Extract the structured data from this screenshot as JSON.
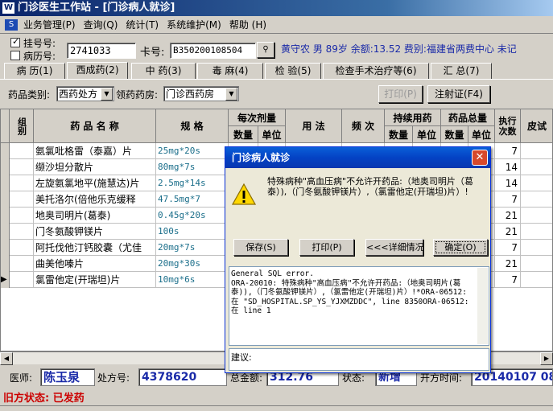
{
  "window": {
    "title": "门诊医生工作站 - [门诊病人就诊]"
  },
  "menu": [
    "业务管理(P)",
    "查询(Q)",
    "统计(T)",
    "系统维护(M)",
    "帮助 (H)"
  ],
  "patient": {
    "regno_label": "挂号号:",
    "caseno_label": "病历号:",
    "regno_value": "2741033",
    "card_label": "卡号:",
    "card_value": "B350200108504",
    "info": "黄守农 男 89岁 余额:13.52 费别:福建省两费中心 未记"
  },
  "tabs": [
    "病 历(1)",
    "西成药(2)",
    "中 药(3)",
    "毒 麻(4)",
    "检 验(5)",
    "检查手术治疗等(6)",
    "汇 总(7)"
  ],
  "toolbar": {
    "category_label": "药品类别:",
    "category_value": "西药处方",
    "pharmacy_label": "领药药房:",
    "pharmacy_value": "门诊西药房",
    "print_button": "打印(P)",
    "injection_button": "注射证(F4)"
  },
  "grid": {
    "headers": {
      "group": "组别",
      "name": "药 品 名 称",
      "spec": "规 格",
      "dose": "每次剂量",
      "dose_qty": "数量",
      "dose_unit": "单位",
      "usage": "用 法",
      "freq": "频 次",
      "duration": "持续用药",
      "dur_qty": "数量",
      "dur_unit": "单位",
      "total": "药品总量",
      "tot_qty": "数量",
      "tot_unit": "单位",
      "exec": "执行次数",
      "skin": "皮试"
    },
    "rows": [
      {
        "name": "氨氯吡格雷（泰嘉）片",
        "spec": "25mg*20s",
        "exec": "7",
        "marker": ""
      },
      {
        "name": "缬沙坦分散片",
        "spec": "80mg*7s",
        "exec": "14",
        "marker": ""
      },
      {
        "name": "左旋氨氯地平(施慧达)片",
        "spec": "2.5mg*14s",
        "exec": "14",
        "marker": ""
      },
      {
        "name": "美托洛尔(倍他乐克缓释",
        "spec": "47.5mg*7",
        "exec": "7",
        "marker": ""
      },
      {
        "name": "地奥司明片(葛泰)",
        "spec": "0.45g*20s",
        "exec": "21",
        "marker": ""
      },
      {
        "name": "门冬氨酸钾镁片",
        "spec": "100s",
        "exec": "21",
        "marker": ""
      },
      {
        "name": "阿托伐他汀钙胶囊（尤佳",
        "spec": "20mg*7s",
        "exec": "7",
        "marker": ""
      },
      {
        "name": "曲美他嗪片",
        "spec": "20mg*30s",
        "exec": "21",
        "marker": ""
      },
      {
        "name": "氯雷他定(开瑞坦)片",
        "spec": "10mg*6s",
        "exec": "7",
        "marker": "▶"
      }
    ]
  },
  "footer": {
    "doctor_label": "医师:",
    "doctor_value": "陈玉泉",
    "rx_label": "处方号:",
    "rx_value": "4378620",
    "total_label": "总金额:",
    "total_value": "312.76",
    "status_label": "状态:",
    "status_value": "新增",
    "open_time_label": "开方时间:",
    "open_time_value": "20140107 08",
    "old_status": "旧方状态: 已发药"
  },
  "dialog": {
    "title": "门诊病人就诊",
    "message": "特殊病种\"高血压病\"不允许开药品:（地奥司明片（葛泰）),（门冬氨酸钾镁片）,（氯雷他定(开瑞坦)片）!",
    "save_button": "保存(S)",
    "print_button": "打印(P)",
    "details_button": "<<<详细情况",
    "ok_button": "确定(O)",
    "log": "General SQL error.\nORA-20010: 特殊病种\"高血压病\"不允许开药品:（地奥司明片(葛泰)),（门冬氨酸钾镁片）,（氯雷他定(开瑞坦)片）!*ORA-06512: 在 \"SD_HOSPITAL.SP_YS_YJXMZDDC\", line 8350ORA-06512: 在 line 1",
    "suggest_label": "建议:"
  },
  "colors": {
    "title_start": "#0a246a",
    "info_text": "#1a2aa8",
    "spec_text": "#1a6e8a",
    "alert_red": "#cc0000"
  }
}
